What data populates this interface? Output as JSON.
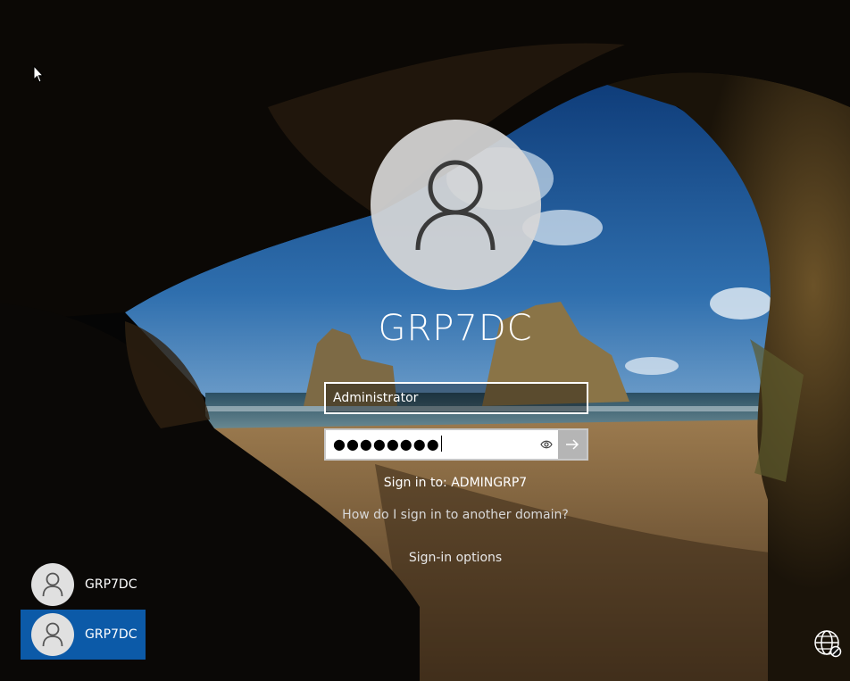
{
  "screen": {
    "username": "GRP7DC",
    "username_field_value": "Administrator",
    "password_masked": "●●●●●●●●",
    "sign_in_to": "Sign in to: ADMINGRP7",
    "domain_link": "How do I sign in to another domain?",
    "sign_in_options": "Sign-in options"
  },
  "user_tiles": [
    {
      "name": "GRP7DC",
      "selected": false
    },
    {
      "name": "GRP7DC",
      "selected": true
    }
  ],
  "icons": {
    "avatar": "user-avatar-icon",
    "reveal": "eye-icon",
    "submit": "arrow-right-icon",
    "network": "network-globe-icon",
    "cursor": "mouse-pointer-icon"
  },
  "colors": {
    "selected_tile": "#0c5aa8",
    "avatar_bg": "#d7d7d7"
  }
}
